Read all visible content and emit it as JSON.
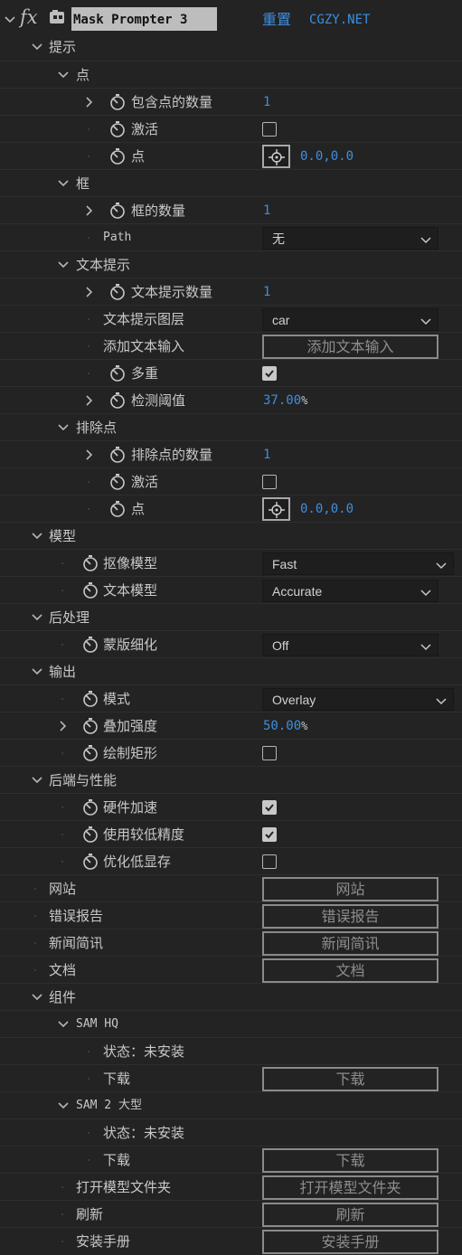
{
  "header": {
    "fx_label": "fx",
    "effect_name": "Mask Prompter 3",
    "reset_label": "重置",
    "link_label": "CGZY.NET"
  },
  "rows": {
    "prompts": "提示",
    "points": "点",
    "points_count": "包含点的数量",
    "points_count_value": "1",
    "points_active": "激活",
    "points_point": "点",
    "points_point_value": "0.0,0.0",
    "boxes": "框",
    "boxes_count": "框的数量",
    "boxes_count_value": "1",
    "path": "Path",
    "path_value": "无",
    "text_prompts": "文本提示",
    "text_count": "文本提示数量",
    "text_count_value": "1",
    "text_layer": "文本提示图层",
    "text_layer_value": "car",
    "add_text_input": "添加文本输入",
    "add_text_input_button": "添加文本输入",
    "multiple": "多重",
    "threshold": "检测阈值",
    "threshold_value": "37.00",
    "threshold_unit": "%",
    "exclude_points": "排除点",
    "exclude_count": "排除点的数量",
    "exclude_count_value": "1",
    "exclude_active": "激活",
    "exclude_point": "点",
    "exclude_point_value": "0.0,0.0",
    "model": "模型",
    "matting_model": "抠像模型",
    "matting_model_value": "Fast",
    "text_model": "文本模型",
    "text_model_value": "Accurate",
    "postprocess": "后处理",
    "mask_refine": "蒙版细化",
    "mask_refine_value": "Off",
    "output": "输出",
    "mode": "模式",
    "mode_value": "Overlay",
    "overlay_strength": "叠加强度",
    "overlay_strength_value": "50.00",
    "overlay_strength_unit": "%",
    "draw_rect": "绘制矩形",
    "backend": "后端与性能",
    "hw_accel": "硬件加速",
    "low_precision": "使用较低精度",
    "optimize_vram": "优化低显存",
    "website": "网站",
    "website_button": "网站",
    "bug_report": "错误报告",
    "bug_report_button": "错误报告",
    "newsletter": "新闻简讯",
    "newsletter_button": "新闻简讯",
    "docs": "文档",
    "docs_button": "文档",
    "components": "组件",
    "sam_hq": "SAM HQ",
    "sam_hq_status": "状态：未安装",
    "sam_hq_download": "下载",
    "sam_hq_download_button": "下载",
    "sam2_large": "SAM 2 大型",
    "sam2_status": "状态：未安装",
    "sam2_download": "下载",
    "sam2_download_button": "下载",
    "open_model_folder": "打开模型文件夹",
    "open_model_folder_button": "打开模型文件夹",
    "refresh": "刷新",
    "refresh_button": "刷新",
    "install_manual": "安装手册",
    "install_manual_button": "安装手册"
  },
  "states": {
    "points_active_checked": false,
    "multiple_checked": true,
    "exclude_active_checked": false,
    "draw_rect_checked": false,
    "hw_accel_checked": true,
    "low_precision_checked": true,
    "optimize_vram_checked": false
  },
  "colors": {
    "panel_bg": "#232323",
    "accent_blue": "#3d8fe0",
    "header_name_bg": "#bdbdbd",
    "text": "#c8c8c8"
  },
  "icons": {
    "expanded": "chevron-down-icon",
    "collapsed": "chevron-right-icon",
    "stopwatch": "stopwatch-icon",
    "crosshair": "crosshair-icon",
    "fx": "fx-icon",
    "effect": "effect-settings-icon"
  }
}
